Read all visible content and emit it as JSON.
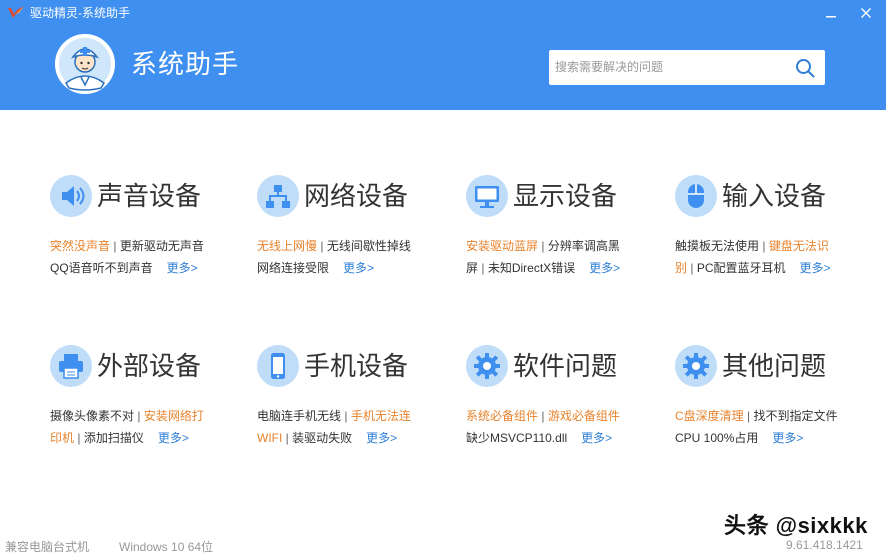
{
  "window": {
    "title": "驱动精灵-系统助手",
    "minimize_glyph": "—",
    "close_glyph": "✕"
  },
  "header": {
    "page_title": "系统助手",
    "search_placeholder": "搜索需要解决的问题"
  },
  "colors": {
    "header_bg": "#3f8ff0",
    "icon_bg": "#bfdcf9",
    "icon_fg": "#3f8ff0",
    "link_orange": "#e8832d",
    "more_blue": "#2f7fd6"
  },
  "categories": [
    {
      "icon": "speaker-icon",
      "title": "声音设备",
      "line1": [
        {
          "text": "突然没声音",
          "hot": true
        },
        {
          "text": "更新驱动无声音",
          "hot": false
        }
      ],
      "line2": [
        {
          "text": "QQ语音听不到声音",
          "hot": false
        }
      ],
      "more": "更多>"
    },
    {
      "icon": "network-icon",
      "title": "网络设备",
      "line1": [
        {
          "text": "无线上网慢",
          "hot": true
        },
        {
          "text": "无线间歇性掉线",
          "hot": false
        }
      ],
      "line2": [
        {
          "text": "网络连接受限",
          "hot": false
        }
      ],
      "more": "更多>"
    },
    {
      "icon": "monitor-icon",
      "title": "显示设备",
      "line1": [
        {
          "text": "安装驱动蓝屏",
          "hot": true
        },
        {
          "text": "分辨率调高黑",
          "hot": false
        }
      ],
      "line2": [
        {
          "text": "屏",
          "hot": false
        },
        {
          "text": "未知DirectX错误",
          "hot": false
        }
      ],
      "more": "更多>"
    },
    {
      "icon": "mouse-icon",
      "title": "输入设备",
      "line1": [
        {
          "text": "触摸板无法使用",
          "hot": false
        },
        {
          "text": "键盘无法识",
          "hot": true
        }
      ],
      "line2": [
        {
          "text": "别",
          "hot": true
        },
        {
          "text": "PC配置蓝牙耳机",
          "hot": false
        }
      ],
      "more": "更多>"
    },
    {
      "icon": "printer-icon",
      "title": "外部设备",
      "line1": [
        {
          "text": "摄像头像素不对",
          "hot": false
        },
        {
          "text": "安装网络打",
          "hot": true
        }
      ],
      "line2": [
        {
          "text": "印机",
          "hot": true
        },
        {
          "text": "添加扫描仪",
          "hot": false
        }
      ],
      "more": "更多>"
    },
    {
      "icon": "phone-icon",
      "title": "手机设备",
      "line1": [
        {
          "text": "电脑连手机无线",
          "hot": false
        },
        {
          "text": "手机无法连",
          "hot": true
        }
      ],
      "line2": [
        {
          "text": "WIFI",
          "hot": true
        },
        {
          "text": "装驱动失败",
          "hot": false
        }
      ],
      "more": "更多>"
    },
    {
      "icon": "gear-icon",
      "title": "软件问题",
      "line1": [
        {
          "text": "系统必备组件",
          "hot": true
        },
        {
          "text": "游戏必备组件",
          "hot": true
        }
      ],
      "line2": [
        {
          "text": "缺少MSVCP110.dll",
          "hot": false
        }
      ],
      "more": "更多>"
    },
    {
      "icon": "gear-icon",
      "title": "其他问题",
      "line1": [
        {
          "text": "C盘深度清理",
          "hot": true
        },
        {
          "text": "找不到指定文件",
          "hot": false
        }
      ],
      "line2": [
        {
          "text": "CPU 100%占用",
          "hot": false
        }
      ],
      "more": "更多>"
    }
  ],
  "status": {
    "machine_type": "兼容电脑台式机",
    "os": "Windows 10 64位",
    "version": "9.61.418.1421"
  },
  "watermark": "头条 @sixkkk"
}
